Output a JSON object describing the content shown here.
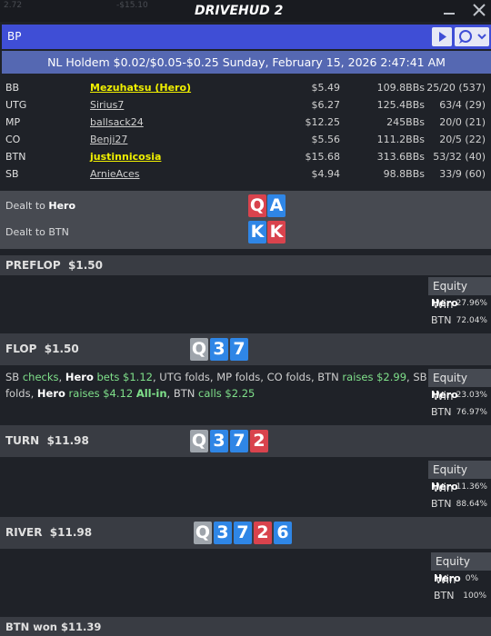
{
  "titlebar": {
    "bg_left": "2.72",
    "bg_right": "-$15.10",
    "app": "DRIVEHUD 2"
  },
  "bp": {
    "label": "BP"
  },
  "header": {
    "text": "NL Holdem $0.02/$0.05-$0.25 Sunday, February 15, 2026 2:47:41 AM"
  },
  "players": [
    {
      "pos": "BB",
      "name": "Mezuhatsu (Hero)",
      "stack": "$5.49",
      "bbs": "109.8BBs",
      "stats": "25/20 (537)",
      "hero": true
    },
    {
      "pos": "UTG",
      "name": "Sirius7",
      "stack": "$6.27",
      "bbs": "125.4BBs",
      "stats": "63/4 (29)",
      "hero": false
    },
    {
      "pos": "MP",
      "name": "ballsack24",
      "stack": "$12.25",
      "bbs": "245BBs",
      "stats": "20/0 (21)",
      "hero": false
    },
    {
      "pos": "CO",
      "name": "Benji27",
      "stack": "$5.56",
      "bbs": "111.2BBs",
      "stats": "20/5 (22)",
      "hero": false
    },
    {
      "pos": "BTN",
      "name": "justinnicosia",
      "stack": "$15.68",
      "bbs": "313.6BBs",
      "stats": "53/32 (40)",
      "hero": true
    },
    {
      "pos": "SB",
      "name": "ArnieAces",
      "stack": "$4.94",
      "bbs": "98.8BBs",
      "stats": "33/9 (60)",
      "hero": false
    }
  ],
  "dealt": {
    "hero_prefix": "Dealt to ",
    "hero_name": "Hero",
    "hero_cards": [
      "Q",
      "A"
    ],
    "btn_prefix": "Dealt to BTN",
    "btn_cards": [
      "K",
      "K"
    ]
  },
  "preflop": {
    "label": "PREFLOP",
    "pot": "$1.50",
    "equity_title": "Equity Win",
    "hero": "Hero",
    "hero_eq": "27.96%",
    "btn": "BTN",
    "btn_eq": "72.04%"
  },
  "flop": {
    "label": "FLOP",
    "pot": "$1.50",
    "cards": [
      "Q",
      "3",
      "7"
    ],
    "actions": {
      "sb": "SB",
      "checks": "checks",
      "c1": ", ",
      "hero": "Hero",
      "bets": "bets",
      "bet_amt": "$1.12",
      "utg": ", UTG",
      "f1": "folds",
      "mp": ", MP",
      "f2": "folds",
      "co": ", CO",
      "f3": "folds",
      "btn": ", BTN",
      "raises": "raises",
      "raise_amt": "$2.99",
      "sb2": ", SB",
      "f4": "folds",
      "c2": ",",
      "hero2": "Hero",
      "raises2": "raises",
      "raise2_amt": "$4.12",
      "allin": "All-in",
      "btn2": ", BTN",
      "calls": "calls",
      "call_amt": "$2.25"
    },
    "equity_title": "Equity Win",
    "hero": "Hero",
    "hero_eq": "23.03%",
    "btn": "BTN",
    "btn_eq": "76.97%"
  },
  "turn": {
    "label": "TURN",
    "pot": "$11.98",
    "cards": [
      "Q",
      "3",
      "7",
      "2"
    ],
    "equity_title": "Equity Win",
    "hero": "Hero",
    "hero_eq": "11.36%",
    "btn": "BTN",
    "btn_eq": "88.64%"
  },
  "river": {
    "label": "RIVER",
    "pot": "$11.98",
    "cards": [
      "Q",
      "3",
      "7",
      "2",
      "6"
    ],
    "equity_title": "Equity Win",
    "hero": "Hero",
    "hero_eq": "0%",
    "btn": "BTN",
    "btn_eq": "100%"
  },
  "footer": {
    "text": "BTN won $11.39"
  },
  "colors": {
    "accent_bar": "#3f4ed6",
    "header": "#5568b2",
    "hero_name": "#f0f000",
    "action_green": "#7fe08a",
    "card_red": "#d9434d",
    "card_blue": "#2f86e6",
    "card_grey": "#9fa5ac"
  }
}
